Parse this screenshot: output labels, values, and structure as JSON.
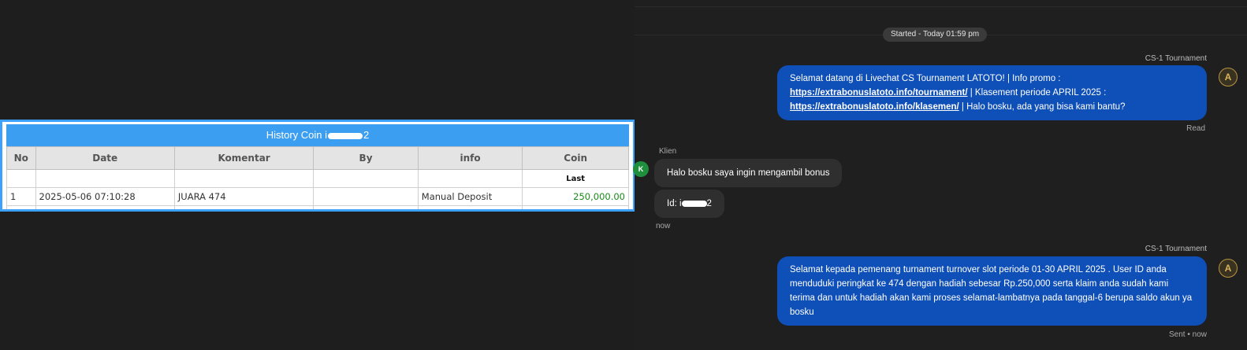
{
  "history": {
    "title_prefix": "History Coin i",
    "title_suffix": "2",
    "headers": [
      "No",
      "Date",
      "Komentar",
      "By",
      "info",
      "Coin"
    ],
    "last_label": "Last",
    "rows": [
      {
        "no": "1",
        "date": "2025-05-06 07:10:28",
        "komentar": "JUARA 474",
        "by": "",
        "info": "Manual Deposit",
        "coin": "250,000.00"
      }
    ]
  },
  "chat": {
    "started": "Started - Today 01:59 pm",
    "agent_name": "CS-1 Tournament",
    "agent_avatar": "A",
    "client_name": "Klien",
    "client_avatar": "K",
    "msg1": {
      "line1": "Selamat datang di Livechat CS Tournament LATOTO! | Info promo :",
      "link1": "https://extrabonuslatoto.info/tournament/",
      "mid": " | Klasement periode APRIL 2025 :",
      "link2": "https://extrabonuslatoto.info/klasemen/",
      "tail": " | Halo bosku, ada yang bisa kami bantu?"
    },
    "read_label": "Read",
    "client_msg1": "Halo bosku saya ingin mengambil bonus",
    "client_msg2_prefix": "Id: i",
    "client_msg2_suffix": "2",
    "client_time": "now",
    "msg2": "Selamat kepada pemenang turnament turnover slot periode 01-30 APRIL 2025 . User ID anda menduduki peringkat ke 474 dengan hadiah sebesar Rp.250,000 serta klaim anda sudah kami terima dan untuk hadiah akan kami proses selamat-lambatnya pada tanggal-6 berupa saldo akun ya bosku",
    "sent_label": "Sent • now"
  }
}
